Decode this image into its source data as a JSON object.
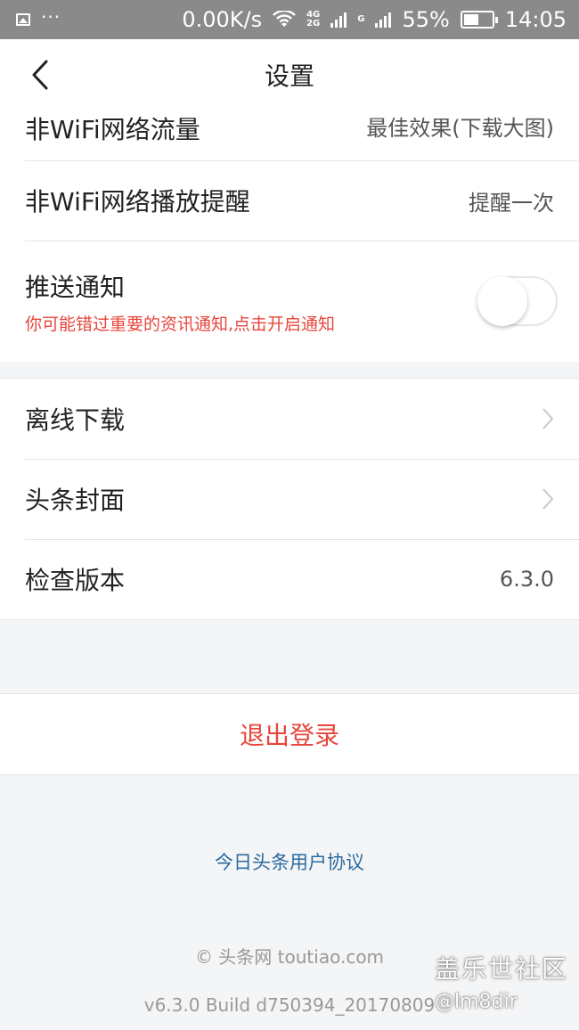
{
  "status_bar": {
    "speed": "0.00K/s",
    "network_top": "4G",
    "network_bottom": "2G",
    "network2": "G",
    "battery": "55%",
    "time": "14:05",
    "battery_level": 0.55
  },
  "navbar": {
    "title": "设置"
  },
  "settings": {
    "wifi_traffic": {
      "label": "非WiFi网络流量",
      "value": "最佳效果(下载大图)"
    },
    "wifi_play_reminder": {
      "label": "非WiFi网络播放提醒",
      "value": "提醒一次"
    },
    "push": {
      "label": "推送通知",
      "warning": "你可能错过重要的资讯通知,点击开启通知",
      "enabled": false
    },
    "offline_download": {
      "label": "离线下载"
    },
    "cover": {
      "label": "头条封面"
    },
    "check_version": {
      "label": "检查版本",
      "value": "6.3.0"
    }
  },
  "logout": {
    "label": "退出登录"
  },
  "footer": {
    "agreement": "今日头条用户协议",
    "copyright": "© 头条网 toutiao.com",
    "build": "v6.3.0 Build d750394_20170809"
  },
  "watermark": {
    "line1": "盖乐世社区",
    "line2": "@lm8dir"
  },
  "colors": {
    "accent_red": "#e8453c",
    "link_blue": "#2c6aa0",
    "status_bar": "#8a8a8a"
  }
}
